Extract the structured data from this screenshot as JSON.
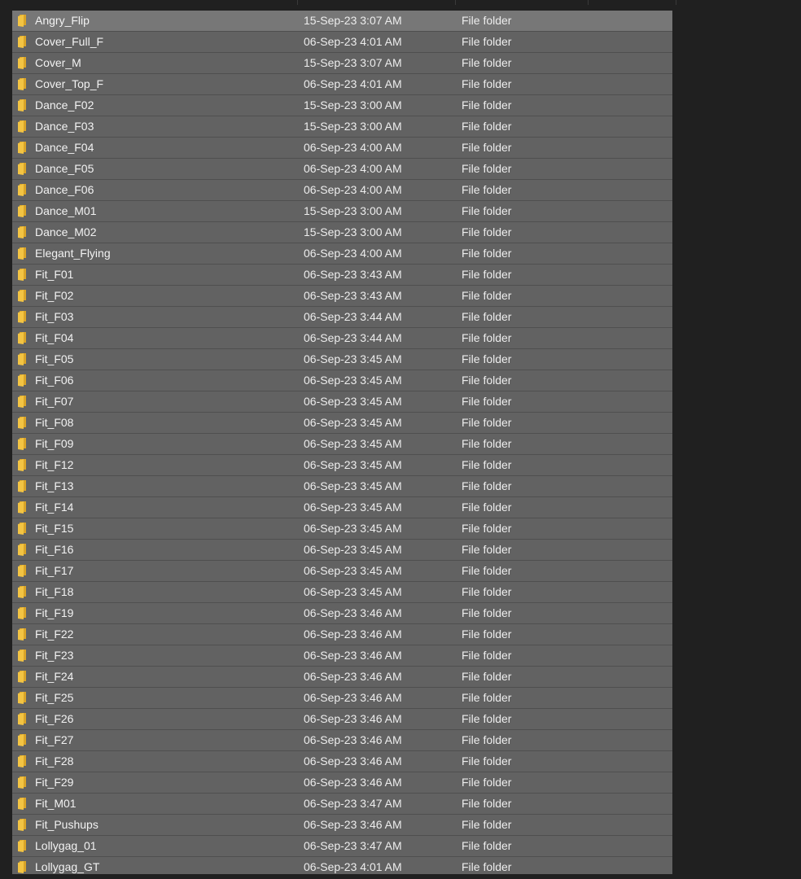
{
  "icons": {
    "folder": "folder-icon"
  },
  "colors": {
    "folder_yellow": "#f3c443",
    "folder_shade": "#d9a428",
    "selection": "#626262"
  },
  "rows": [
    {
      "name": "Angry_Flip",
      "date": "15-Sep-23 3:07 AM",
      "type": "File folder"
    },
    {
      "name": "Cover_Full_F",
      "date": "06-Sep-23 4:01 AM",
      "type": "File folder"
    },
    {
      "name": "Cover_M",
      "date": "15-Sep-23 3:07 AM",
      "type": "File folder"
    },
    {
      "name": "Cover_Top_F",
      "date": "06-Sep-23 4:01 AM",
      "type": "File folder"
    },
    {
      "name": "Dance_F02",
      "date": "15-Sep-23 3:00 AM",
      "type": "File folder"
    },
    {
      "name": "Dance_F03",
      "date": "15-Sep-23 3:00 AM",
      "type": "File folder"
    },
    {
      "name": "Dance_F04",
      "date": "06-Sep-23 4:00 AM",
      "type": "File folder"
    },
    {
      "name": "Dance_F05",
      "date": "06-Sep-23 4:00 AM",
      "type": "File folder"
    },
    {
      "name": "Dance_F06",
      "date": "06-Sep-23 4:00 AM",
      "type": "File folder"
    },
    {
      "name": "Dance_M01",
      "date": "15-Sep-23 3:00 AM",
      "type": "File folder"
    },
    {
      "name": "Dance_M02",
      "date": "15-Sep-23 3:00 AM",
      "type": "File folder"
    },
    {
      "name": "Elegant_Flying",
      "date": "06-Sep-23 4:00 AM",
      "type": "File folder"
    },
    {
      "name": "Fit_F01",
      "date": "06-Sep-23 3:43 AM",
      "type": "File folder"
    },
    {
      "name": "Fit_F02",
      "date": "06-Sep-23 3:43 AM",
      "type": "File folder"
    },
    {
      "name": "Fit_F03",
      "date": "06-Sep-23 3:44 AM",
      "type": "File folder"
    },
    {
      "name": "Fit_F04",
      "date": "06-Sep-23 3:44 AM",
      "type": "File folder"
    },
    {
      "name": "Fit_F05",
      "date": "06-Sep-23 3:45 AM",
      "type": "File folder"
    },
    {
      "name": "Fit_F06",
      "date": "06-Sep-23 3:45 AM",
      "type": "File folder"
    },
    {
      "name": "Fit_F07",
      "date": "06-Sep-23 3:45 AM",
      "type": "File folder"
    },
    {
      "name": "Fit_F08",
      "date": "06-Sep-23 3:45 AM",
      "type": "File folder"
    },
    {
      "name": "Fit_F09",
      "date": "06-Sep-23 3:45 AM",
      "type": "File folder"
    },
    {
      "name": "Fit_F12",
      "date": "06-Sep-23 3:45 AM",
      "type": "File folder"
    },
    {
      "name": "Fit_F13",
      "date": "06-Sep-23 3:45 AM",
      "type": "File folder"
    },
    {
      "name": "Fit_F14",
      "date": "06-Sep-23 3:45 AM",
      "type": "File folder"
    },
    {
      "name": "Fit_F15",
      "date": "06-Sep-23 3:45 AM",
      "type": "File folder"
    },
    {
      "name": "Fit_F16",
      "date": "06-Sep-23 3:45 AM",
      "type": "File folder"
    },
    {
      "name": "Fit_F17",
      "date": "06-Sep-23 3:45 AM",
      "type": "File folder"
    },
    {
      "name": "Fit_F18",
      "date": "06-Sep-23 3:45 AM",
      "type": "File folder"
    },
    {
      "name": "Fit_F19",
      "date": "06-Sep-23 3:46 AM",
      "type": "File folder"
    },
    {
      "name": "Fit_F22",
      "date": "06-Sep-23 3:46 AM",
      "type": "File folder"
    },
    {
      "name": "Fit_F23",
      "date": "06-Sep-23 3:46 AM",
      "type": "File folder"
    },
    {
      "name": "Fit_F24",
      "date": "06-Sep-23 3:46 AM",
      "type": "File folder"
    },
    {
      "name": "Fit_F25",
      "date": "06-Sep-23 3:46 AM",
      "type": "File folder"
    },
    {
      "name": "Fit_F26",
      "date": "06-Sep-23 3:46 AM",
      "type": "File folder"
    },
    {
      "name": "Fit_F27",
      "date": "06-Sep-23 3:46 AM",
      "type": "File folder"
    },
    {
      "name": "Fit_F28",
      "date": "06-Sep-23 3:46 AM",
      "type": "File folder"
    },
    {
      "name": "Fit_F29",
      "date": "06-Sep-23 3:46 AM",
      "type": "File folder"
    },
    {
      "name": "Fit_M01",
      "date": "06-Sep-23 3:47 AM",
      "type": "File folder"
    },
    {
      "name": "Fit_Pushups",
      "date": "06-Sep-23 3:46 AM",
      "type": "File folder"
    },
    {
      "name": "Lollygag_01",
      "date": "06-Sep-23 3:47 AM",
      "type": "File folder"
    },
    {
      "name": "Lollygag_GT",
      "date": "06-Sep-23 4:01 AM",
      "type": "File folder"
    }
  ]
}
